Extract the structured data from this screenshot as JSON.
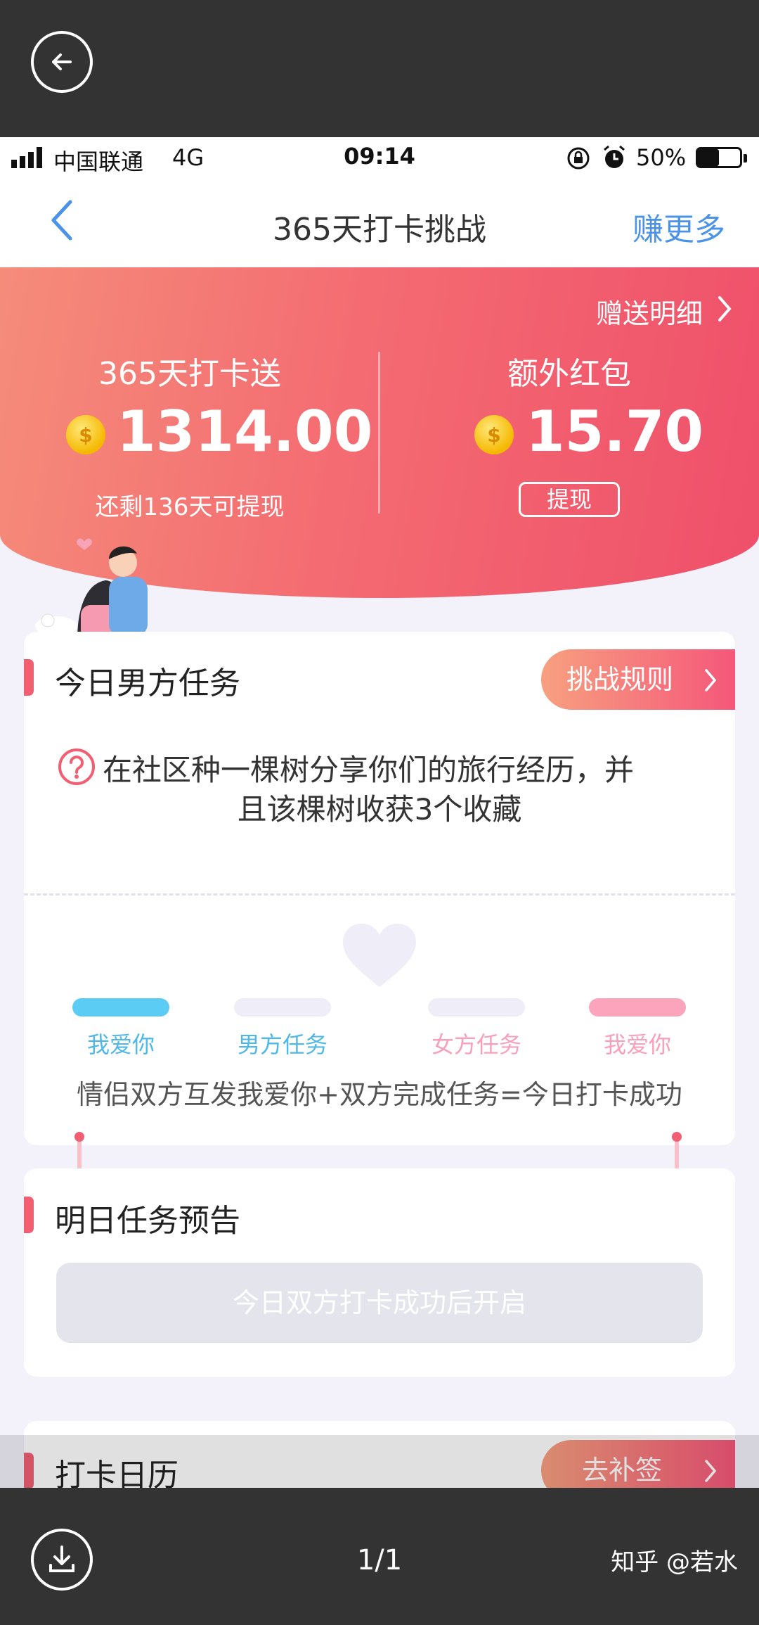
{
  "viewer": {
    "back_icon": "arrow-left-icon",
    "download_icon": "download-icon",
    "pager": "1/1",
    "watermark": "知乎 @若水"
  },
  "status_bar": {
    "carrier": "中国联通",
    "network": "4G",
    "time": "09:14",
    "battery": "50%",
    "battery_level": 0.5
  },
  "nav": {
    "title": "365天打卡挑战",
    "right_label": "赚更多"
  },
  "hero": {
    "detail_link": "赠送明细",
    "left_title": "365天打卡送",
    "left_amount": "1314.00",
    "left_note": "还剩136天可提现",
    "right_title": "额外红包",
    "right_amount": "15.70",
    "withdraw_label": "提现",
    "coin_symbol": "$"
  },
  "today_task": {
    "title": "今日男方任务",
    "rules_button": "挑战规则",
    "task_text_line1": "在社区种一棵树分享你们的旅行经历，并",
    "task_text_line2": "且该棵树收获3个收藏",
    "progress_labels": [
      "我爱你",
      "男方任务",
      "女方任务",
      "我爱你"
    ],
    "progress_colors": [
      "#5bcdf5",
      "#efeef8",
      "#efeef8",
      "#fda4bd"
    ],
    "label_colors": [
      "#4fb8e6",
      "#4fb8e6",
      "#f8a0b8",
      "#f8a0b8"
    ],
    "formula": "情侣双方互发我爱你+双方完成任务=今日打卡成功"
  },
  "tomorrow": {
    "title": "明日任务预告",
    "locked_text": "今日双方打卡成功后开启"
  },
  "calendar": {
    "title": "打卡日历",
    "makeup_button": "去补签"
  },
  "colors": {
    "accent_blue": "#4b93e8",
    "hero_start": "#f58c7a",
    "hero_end": "#ef4f6a",
    "pink_accent": "#f25f72"
  }
}
